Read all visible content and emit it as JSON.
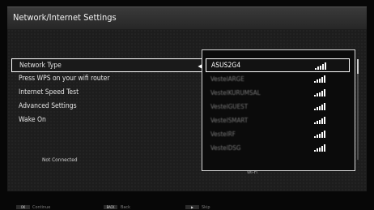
{
  "header": {
    "title": "Network/Internet Settings"
  },
  "menu": {
    "items": [
      {
        "label": "Network Type"
      },
      {
        "label": "Press WPS on your wifi router"
      },
      {
        "label": "Internet Speed Test"
      },
      {
        "label": "Advanced Settings"
      },
      {
        "label": "Wake On"
      }
    ],
    "selected_arrow": "◀"
  },
  "status": {
    "connection": "Not Connected",
    "wifi_label": "Wi-Fi"
  },
  "networks": [
    {
      "name": "ASUS2G4",
      "signal_bars": 5
    },
    {
      "name": "VestelARGE",
      "signal_bars": 5
    },
    {
      "name": "VestelKURUMSAL",
      "signal_bars": 5
    },
    {
      "name": "VestelGUEST",
      "signal_bars": 5
    },
    {
      "name": "VestelSMART",
      "signal_bars": 5
    },
    {
      "name": "VestelRF",
      "signal_bars": 5
    },
    {
      "name": "VestelDSG",
      "signal_bars": 5
    }
  ],
  "footer": {
    "continue_key": "OK",
    "continue_label": "Continue",
    "back_key": "BACK",
    "back_label": "Back",
    "skip_key": "▶",
    "skip_label": "Skip"
  }
}
